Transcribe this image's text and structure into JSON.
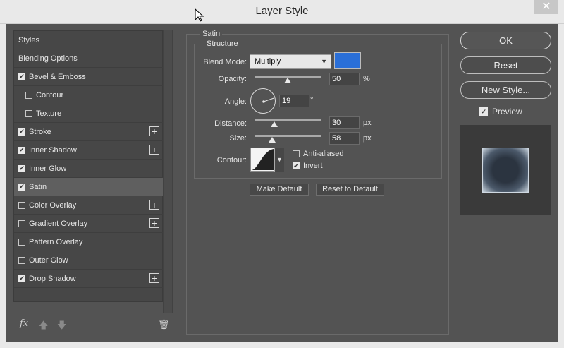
{
  "window": {
    "title": "Layer Style",
    "close_glyph": "✕"
  },
  "style_list": {
    "items": [
      {
        "label": "Styles",
        "checkbox": false,
        "checked": false,
        "plus": false,
        "indent": false,
        "selected": false
      },
      {
        "label": "Blending Options",
        "checkbox": false,
        "checked": false,
        "plus": false,
        "indent": false,
        "selected": false
      },
      {
        "label": "Bevel & Emboss",
        "checkbox": true,
        "checked": true,
        "plus": false,
        "indent": false,
        "selected": false
      },
      {
        "label": "Contour",
        "checkbox": true,
        "checked": false,
        "plus": false,
        "indent": true,
        "selected": false
      },
      {
        "label": "Texture",
        "checkbox": true,
        "checked": false,
        "plus": false,
        "indent": true,
        "selected": false
      },
      {
        "label": "Stroke",
        "checkbox": true,
        "checked": true,
        "plus": true,
        "indent": false,
        "selected": false
      },
      {
        "label": "Inner Shadow",
        "checkbox": true,
        "checked": true,
        "plus": true,
        "indent": false,
        "selected": false
      },
      {
        "label": "Inner Glow",
        "checkbox": true,
        "checked": true,
        "plus": false,
        "indent": false,
        "selected": false
      },
      {
        "label": "Satin",
        "checkbox": true,
        "checked": true,
        "plus": false,
        "indent": false,
        "selected": true
      },
      {
        "label": "Color Overlay",
        "checkbox": true,
        "checked": false,
        "plus": true,
        "indent": false,
        "selected": false
      },
      {
        "label": "Gradient Overlay",
        "checkbox": true,
        "checked": false,
        "plus": true,
        "indent": false,
        "selected": false
      },
      {
        "label": "Pattern Overlay",
        "checkbox": true,
        "checked": false,
        "plus": false,
        "indent": false,
        "selected": false
      },
      {
        "label": "Outer Glow",
        "checkbox": true,
        "checked": false,
        "plus": false,
        "indent": false,
        "selected": false
      },
      {
        "label": "Drop Shadow",
        "checkbox": true,
        "checked": true,
        "plus": true,
        "indent": false,
        "selected": false
      }
    ],
    "footer": {
      "fx": "fx",
      "up_glyph": "🡅",
      "down_glyph": "🡇",
      "trash_glyph": "🗑"
    }
  },
  "satin": {
    "group_label": "Satin",
    "structure_label": "Structure",
    "blend_mode": {
      "label": "Blend Mode:",
      "value": "Multiply",
      "color": "#2a6fd8"
    },
    "opacity": {
      "label": "Opacity:",
      "value": "50",
      "unit": "%",
      "slider_fraction": 0.5
    },
    "angle": {
      "label": "Angle:",
      "value": "19",
      "unit": "°",
      "degrees": 19
    },
    "distance": {
      "label": "Distance:",
      "value": "30",
      "unit": "px",
      "slider_fraction": 0.3
    },
    "size": {
      "label": "Size:",
      "value": "58",
      "unit": "px",
      "slider_fraction": 0.27
    },
    "contour": {
      "label": "Contour:"
    },
    "anti_aliased": {
      "label": "Anti-aliased",
      "checked": false
    },
    "invert": {
      "label": "Invert",
      "checked": true
    },
    "make_default": "Make Default",
    "reset_default": "Reset to Default"
  },
  "actions": {
    "ok": "OK",
    "reset": "Reset",
    "new_style": "New Style...",
    "preview": {
      "label": "Preview",
      "checked": true
    }
  }
}
